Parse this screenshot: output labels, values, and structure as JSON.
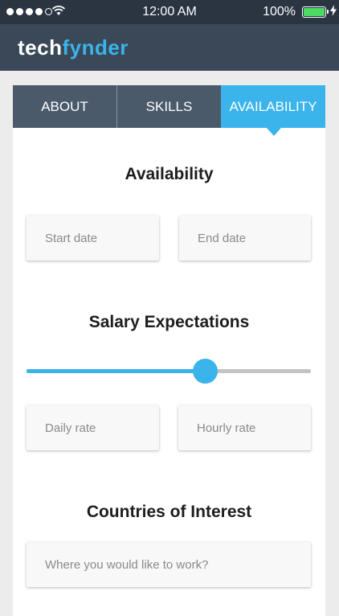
{
  "status_bar": {
    "signal_dots_filled": 4,
    "signal_dots_total": 5,
    "time": "12:00 AM",
    "battery_percent": "100%",
    "battery_color": "#4cd964"
  },
  "header": {
    "logo_part1": "tech",
    "logo_part2": "fynder",
    "background": "#3a4858",
    "accent": "#3ab4ea"
  },
  "tabs": [
    {
      "label": "ABOUT",
      "active": false
    },
    {
      "label": "SKILLS",
      "active": false
    },
    {
      "label": "AVAILABILITY",
      "active": true
    }
  ],
  "availability": {
    "title": "Availability",
    "start_date_placeholder": "Start date",
    "end_date_placeholder": "End date"
  },
  "salary": {
    "title": "Salary Expectations",
    "slider_value_fraction": 0.62,
    "daily_rate_placeholder": "Daily rate",
    "hourly_rate_placeholder": "Hourly rate"
  },
  "countries": {
    "title": "Countries of Interest",
    "placeholder": "Where you would like to work?"
  }
}
